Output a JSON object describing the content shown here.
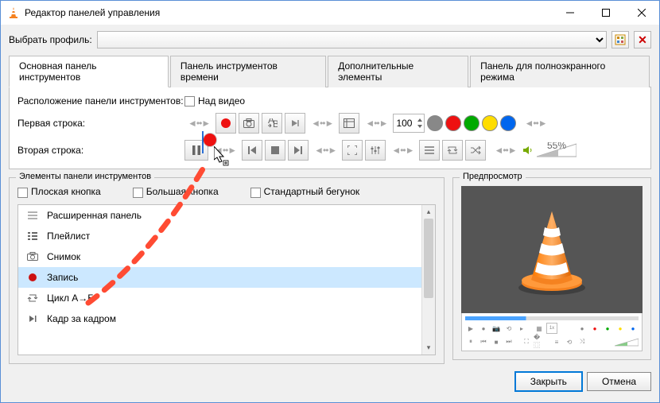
{
  "window": {
    "title": "Редактор панелей управления"
  },
  "profile": {
    "label": "Выбрать профиль:"
  },
  "tabs": [
    "Основная панель инструментов",
    "Панель инструментов времени",
    "Дополнительные элементы",
    "Панель для полноэкранного режима"
  ],
  "activeTab": 0,
  "placement": {
    "label": "Расположение панели инструментов:",
    "checkbox": "Над видео"
  },
  "row1": {
    "label": "Первая строка:",
    "zoom": "100"
  },
  "row2": {
    "label": "Вторая строка:",
    "volume": "55%"
  },
  "swatches": [
    "#888888",
    "#e11",
    "#0a0",
    "#fd0",
    "#06e"
  ],
  "elements": {
    "title": "Элементы панели инструментов",
    "opts": [
      "Плоская кнопка",
      "Большая кнопка",
      "Стандартный бегунок"
    ],
    "items": [
      {
        "icon": "bars",
        "label": "Расширенная панель"
      },
      {
        "icon": "list",
        "label": "Плейлист"
      },
      {
        "icon": "camera",
        "label": "Снимок"
      },
      {
        "icon": "rec",
        "label": "Запись",
        "selected": true
      },
      {
        "icon": "loop",
        "label": "Цикл A→Б"
      },
      {
        "icon": "step",
        "label": "Кадр за кадром"
      }
    ]
  },
  "preview": {
    "title": "Предпросмотр"
  },
  "footer": {
    "close": "Закрыть",
    "cancel": "Отмена"
  }
}
